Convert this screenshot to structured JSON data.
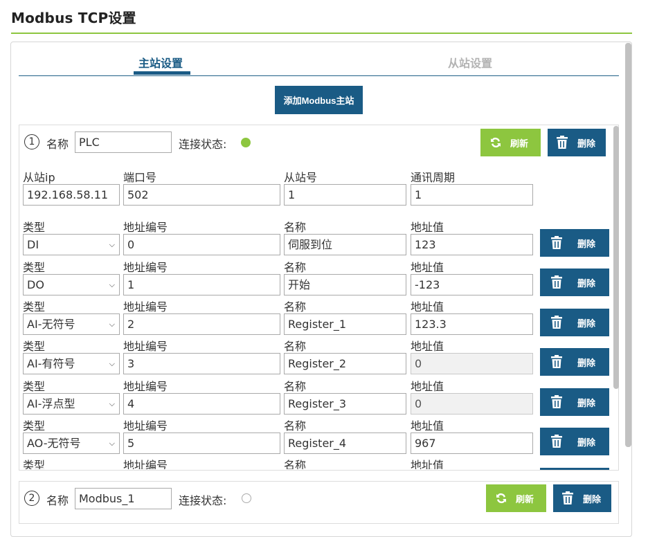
{
  "page": {
    "title": "Modbus TCP设置"
  },
  "tabs": [
    {
      "label": "主站设置"
    },
    {
      "label": "从站设置"
    }
  ],
  "add_master_label": "添加Modbus主站",
  "labels": {
    "name": "名称",
    "conn_status": "连接状态:",
    "refresh": "刷新",
    "delete": "删除",
    "slave_ip": "从站ip",
    "port": "端口号",
    "slave_id": "从站号",
    "poll_period": "通讯周期",
    "type": "类型",
    "addr_num": "地址编号",
    "reg_name": "名称",
    "addr_value": "地址值"
  },
  "masters": [
    {
      "index": "1",
      "name": "PLC",
      "connected": true,
      "slave_ip": "192.168.58.11",
      "port": "502",
      "slave_id": "1",
      "poll_period": "1",
      "registers": [
        {
          "type": "DI",
          "addr": "0",
          "name": "伺服到位",
          "value": "123",
          "readonly": false
        },
        {
          "type": "DO",
          "addr": "1",
          "name": "开始",
          "value": "-123",
          "readonly": false
        },
        {
          "type": "AI-无符号",
          "addr": "2",
          "name": "Register_1",
          "value": "123.3",
          "readonly": false
        },
        {
          "type": "AI-有符号",
          "addr": "3",
          "name": "Register_2",
          "value": "0",
          "readonly": true
        },
        {
          "type": "AI-浮点型",
          "addr": "4",
          "name": "Register_3",
          "value": "0",
          "readonly": true
        },
        {
          "type": "AO-无符号",
          "addr": "5",
          "name": "Register_4",
          "value": "967",
          "readonly": false
        }
      ]
    },
    {
      "index": "2",
      "name": "Modbus_1",
      "connected": false
    }
  ],
  "colors": {
    "accent_blue": "#1a5b85",
    "accent_green": "#8dc63f"
  }
}
